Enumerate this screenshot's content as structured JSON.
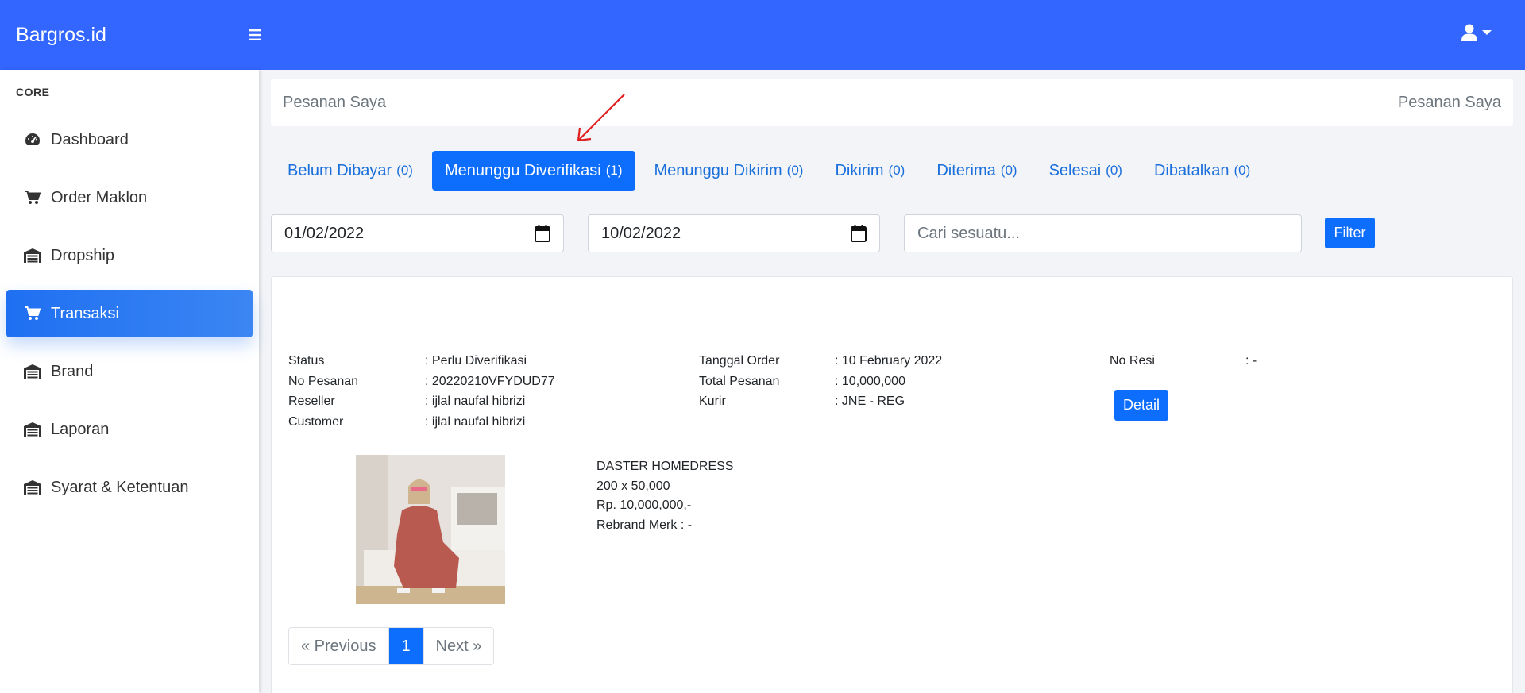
{
  "app": {
    "brand": "Bargros.id"
  },
  "colors": {
    "navbar": "#3366ff",
    "primary": "#0d6efd",
    "active_nav": "#1f6ff2"
  },
  "sidebar": {
    "heading": "CORE",
    "items": [
      {
        "label": "Dashboard",
        "icon": "gauge-icon"
      },
      {
        "label": "Order Maklon",
        "icon": "cart-icon"
      },
      {
        "label": "Dropship",
        "icon": "warehouse-icon"
      },
      {
        "label": "Transaksi",
        "icon": "cart-icon",
        "active": true
      },
      {
        "label": "Brand",
        "icon": "warehouse-icon"
      },
      {
        "label": "Laporan",
        "icon": "warehouse-icon"
      },
      {
        "label": "Syarat & Ketentuan",
        "icon": "warehouse-icon"
      }
    ]
  },
  "breadcrumb": {
    "left": "Pesanan Saya",
    "right": "Pesanan Saya"
  },
  "tabs": [
    {
      "label": "Belum Dibayar",
      "count": "(0)"
    },
    {
      "label": "Menunggu Diverifikasi",
      "count": "(1)",
      "active": true
    },
    {
      "label": "Menunggu Dikirim",
      "count": "(0)"
    },
    {
      "label": "Dikirim",
      "count": "(0)"
    },
    {
      "label": "Diterima",
      "count": "(0)"
    },
    {
      "label": "Selesai",
      "count": "(0)"
    },
    {
      "label": "Dibatalkan",
      "count": "(0)"
    }
  ],
  "filter": {
    "date_from": "01/02/2022",
    "date_to": "10/02/2022",
    "search_placeholder": "Cari sesuatu...",
    "button": "Filter"
  },
  "order": {
    "col1": [
      {
        "k": "Status",
        "v": ": Perlu Diverifikasi"
      },
      {
        "k": "No Pesanan",
        "v": ": 20220210VFYDUD77"
      },
      {
        "k": "Reseller",
        "v": ": ijlal naufal hibrizi"
      },
      {
        "k": "Customer",
        "v": ": ijlal naufal hibrizi"
      }
    ],
    "col2": [
      {
        "k": "Tanggal Order",
        "v": ": 10 February 2022"
      },
      {
        "k": "Total Pesanan",
        "v": ": 10,000,000"
      },
      {
        "k": "Kurir",
        "v": ": JNE - REG"
      }
    ],
    "col3": [
      {
        "k": "No Resi",
        "v": ": -"
      }
    ],
    "detail_button": "Detail",
    "product": {
      "name": "DASTER HOMEDRESS",
      "qty_price": "200 x 50,000",
      "total": "Rp. 10,000,000,-",
      "rebrand": "Rebrand Merk : -"
    }
  },
  "pagination": {
    "previous": "« Previous",
    "current": "1",
    "next": "Next »"
  }
}
